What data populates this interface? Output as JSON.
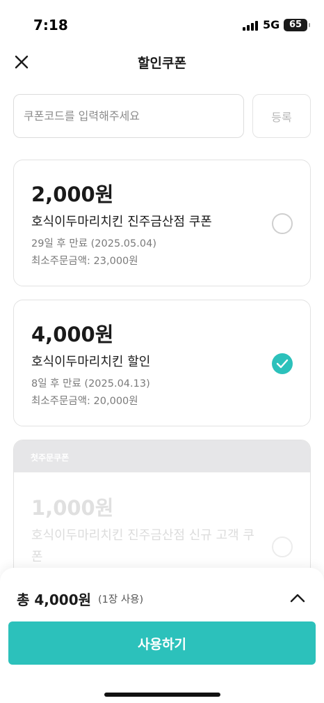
{
  "status_bar": {
    "time": "7:18",
    "network": "5G",
    "battery": "65"
  },
  "header": {
    "title": "할인쿠폰",
    "close_icon": "close-icon"
  },
  "coupon_code": {
    "placeholder": "쿠폰코드를 입력해주세요",
    "value": "",
    "register_label": "등록"
  },
  "coupons": [
    {
      "amount": "2,000원",
      "name": "호식이두마리치킨 진주금산점 쿠폰",
      "expiry": "29일 후 만료 (2025.05.04)",
      "min_order": "최소주문금액: 23,000원",
      "selected": false
    },
    {
      "amount": "4,000원",
      "name": "호식이두마리치킨 할인",
      "expiry": "8일 후 만료 (2025.04.13)",
      "min_order": "최소주문금액: 20,000원",
      "selected": true
    },
    {
      "tag": "첫주문쿠폰",
      "amount": "1,000원",
      "name": "호식이두마리치킨 진주금산점 신규 고객 쿠폰",
      "selected": false,
      "disabled": true
    }
  ],
  "summary": {
    "total": "총 4,000원",
    "count": "(1장 사용)",
    "use_button": "사용하기"
  },
  "colors": {
    "accent": "#2cc1bb",
    "border": "#e2e2e2",
    "muted_text": "#7a7a7a"
  }
}
